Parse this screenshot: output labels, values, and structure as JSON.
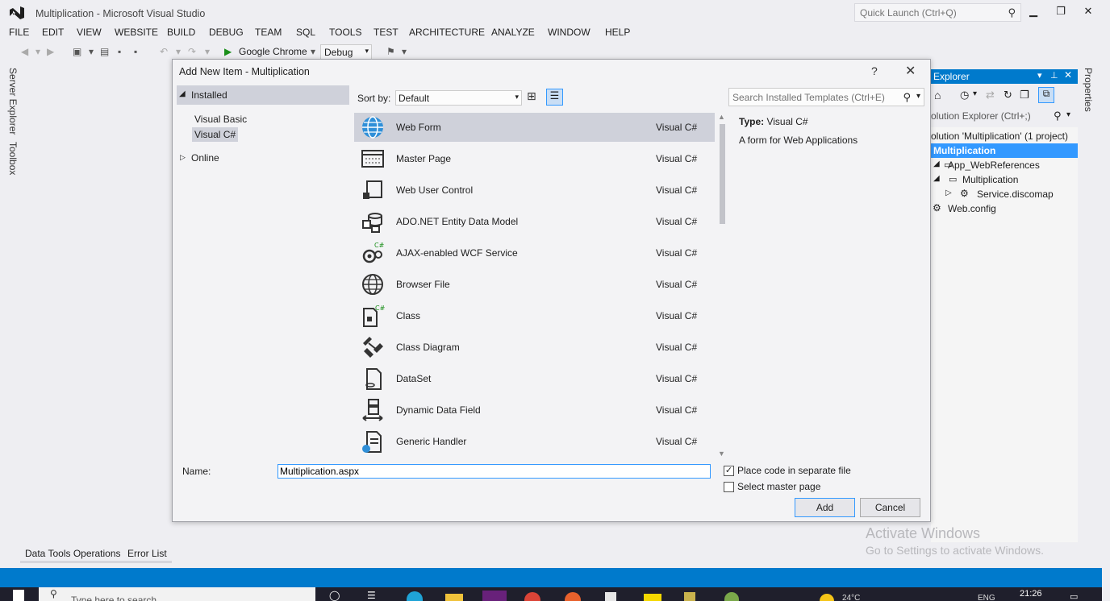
{
  "window": {
    "title": "Multiplication - Microsoft Visual Studio",
    "quick_launch_placeholder": "Quick Launch (Ctrl+Q)"
  },
  "menu": [
    "FILE",
    "EDIT",
    "VIEW",
    "WEBSITE",
    "BUILD",
    "DEBUG",
    "TEAM",
    "SQL",
    "TOOLS",
    "TEST",
    "ARCHITECTURE",
    "ANALYZE",
    "WINDOW",
    "HELP"
  ],
  "toolbar": {
    "run_target": "Google Chrome",
    "configuration": "Debug"
  },
  "side_tabs": {
    "server_explorer": "Server Explorer",
    "toolbox": "Toolbox"
  },
  "dialog": {
    "title": "Add New Item - Multiplication",
    "help_label": "?",
    "tree": {
      "installed": "Installed",
      "visual_basic": "Visual Basic",
      "visual_csharp": "Visual C#",
      "online": "Online"
    },
    "sort_by_label": "Sort by:",
    "sort_by_value": "Default",
    "search_placeholder": "Search Installed Templates (Ctrl+E)",
    "templates": [
      {
        "name": "Web Form",
        "lang": "Visual C#",
        "icon": "globe-icon"
      },
      {
        "name": "Master Page",
        "lang": "Visual C#",
        "icon": "master-page-icon"
      },
      {
        "name": "Web User Control",
        "lang": "Visual C#",
        "icon": "user-control-icon"
      },
      {
        "name": "ADO.NET Entity Data Model",
        "lang": "Visual C#",
        "icon": "entity-model-icon"
      },
      {
        "name": "AJAX-enabled WCF Service",
        "lang": "Visual C#",
        "icon": "wcf-service-icon"
      },
      {
        "name": "Browser File",
        "lang": "Visual C#",
        "icon": "globe-icon"
      },
      {
        "name": "Class",
        "lang": "Visual C#",
        "icon": "class-icon"
      },
      {
        "name": "Class Diagram",
        "lang": "Visual C#",
        "icon": "class-diagram-icon"
      },
      {
        "name": "DataSet",
        "lang": "Visual C#",
        "icon": "dataset-icon"
      },
      {
        "name": "Dynamic Data Field",
        "lang": "Visual C#",
        "icon": "data-field-icon"
      },
      {
        "name": "Generic Handler",
        "lang": "Visual C#",
        "icon": "handler-icon"
      }
    ],
    "details": {
      "type_label": "Type:",
      "type_value": "Visual C#",
      "description": "A form for Web Applications"
    },
    "name_label": "Name:",
    "name_value": "Multiplication.aspx",
    "place_code_label": "Place code in separate file",
    "place_code_checked": true,
    "master_page_label": "Select master page",
    "master_page_checked": false,
    "add_label": "Add",
    "cancel_label": "Cancel"
  },
  "solution_explorer": {
    "header": "Explorer",
    "search_placeholder": "olution Explorer (Ctrl+;)",
    "solution": "olution 'Multiplication' (1 project)",
    "project": "Multiplication",
    "items": [
      {
        "label": "App_WebReferences"
      },
      {
        "label": "Multiplication"
      },
      {
        "label": "Service.discomap"
      },
      {
        "label": "Web.config"
      }
    ]
  },
  "properties_tab": "Properties",
  "activate": {
    "line1": "Activate Windows",
    "line2": "Go to Settings to activate Windows."
  },
  "bottom_tabs": [
    "Data Tools Operations",
    "Error List"
  ],
  "taskbar": {
    "search_placeholder": "Type here to search",
    "time": "21:26",
    "language": "ENG",
    "weather": "24°C"
  },
  "colors": {
    "accent": "#007acc",
    "selection": "#cfd1da",
    "vs_purple": "#68217a"
  }
}
